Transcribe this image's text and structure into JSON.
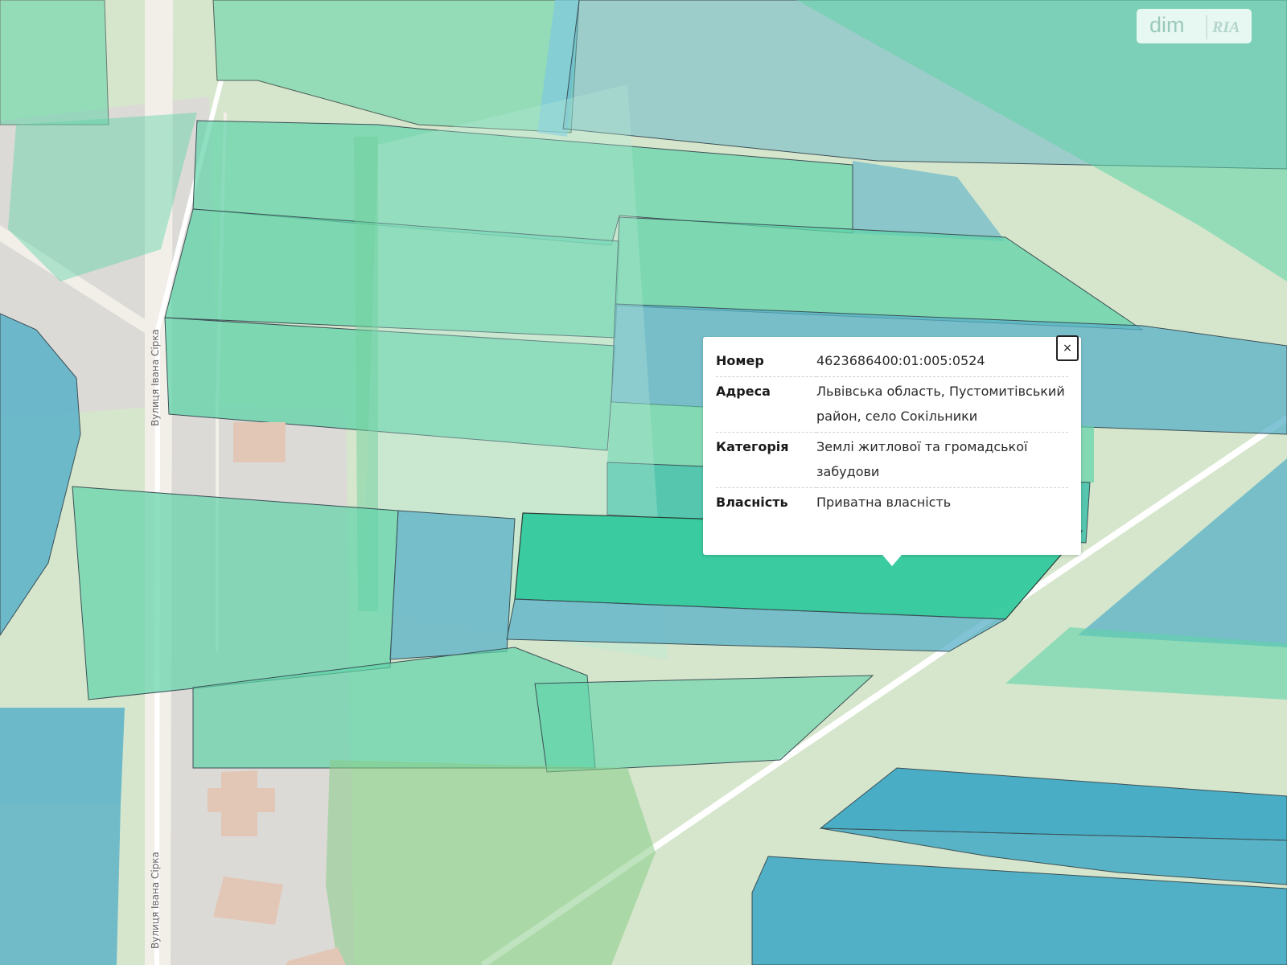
{
  "map": {
    "colors": {
      "background": "#d6e6cc",
      "road": "#f2efe9",
      "parcel_green": "#5fd3a8",
      "parcel_blue": "#58b0c8",
      "selected_parcel": "#33c99d"
    },
    "street_labels": [
      "Вулиця Івана Сірка",
      "Вулиця Івана Сірка"
    ]
  },
  "popup": {
    "close_icon": "close-icon",
    "close_label": "×",
    "rows": [
      {
        "key": "Номер",
        "value": "4623686400:01:005:0524"
      },
      {
        "key": "Адреса",
        "value": "Львівська область, Пустомитівський район, село Сокільники"
      },
      {
        "key": "Категорія",
        "value": "Землі житлової та громадської забудови"
      },
      {
        "key": "Власність",
        "value": "Приватна власність"
      }
    ]
  },
  "logo": {
    "dim": "dim",
    "ria": "RIA"
  }
}
